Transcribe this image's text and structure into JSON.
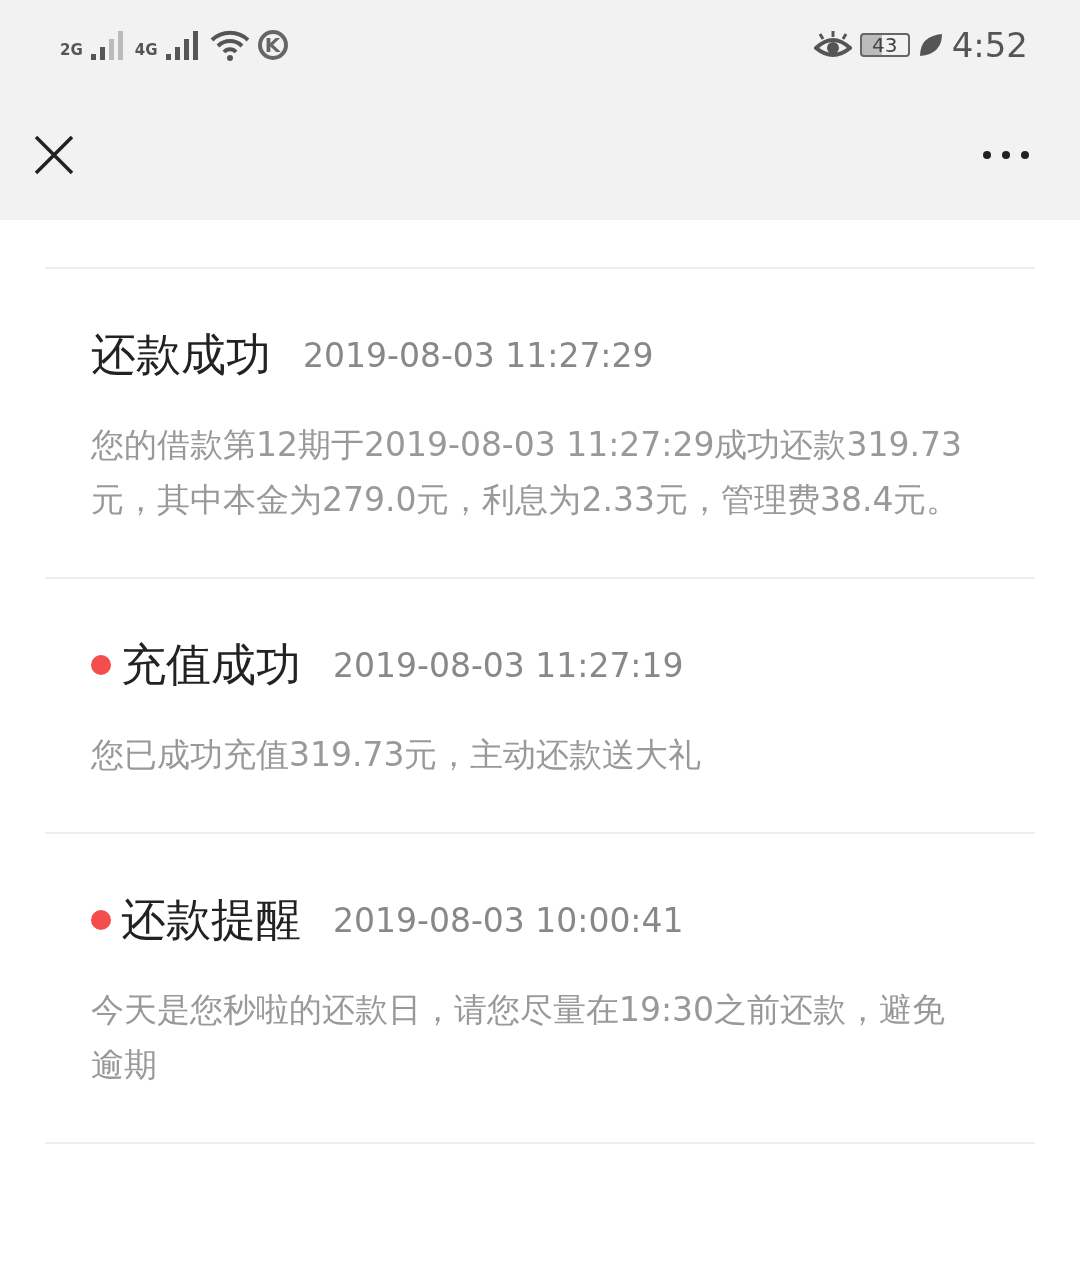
{
  "status_bar": {
    "sim_1": "2G",
    "sim_2": "4G",
    "k_badge": "K",
    "battery": "43",
    "time": "4:52"
  },
  "messages": [
    {
      "title": "还款成功",
      "time": "2019-08-03 11:27:29",
      "body": "您的借款第12期于2019-08-03 11:27:29成功还款319.73元，其中本金为279.0元，利息为2.33元，管理费38.4元。",
      "unread": false
    },
    {
      "title": "充值成功",
      "time": "2019-08-03 11:27:19",
      "body": "您已成功充值319.73元，主动还款送大礼",
      "unread": true
    },
    {
      "title": "还款提醒",
      "time": "2019-08-03 10:00:41",
      "body": "今天是您秒啦的还款日，请您尽量在19:30之前还款，避免逾期",
      "unread": true
    }
  ]
}
